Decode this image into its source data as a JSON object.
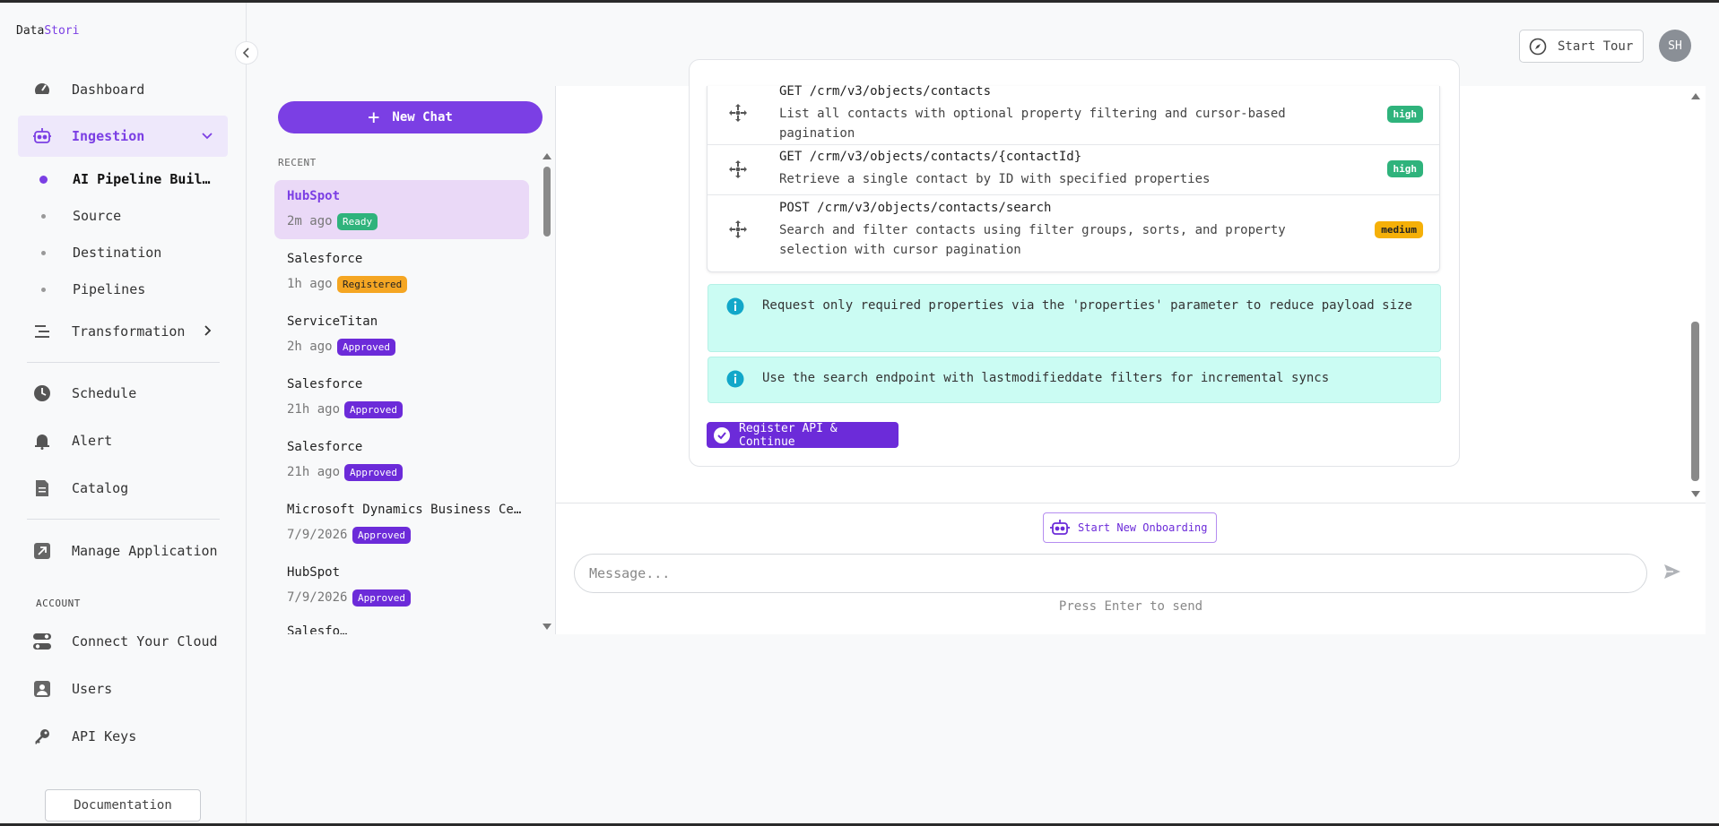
{
  "brand": {
    "part1": "Data",
    "part2": "Stori"
  },
  "sidebar": {
    "items": [
      {
        "label": "Dashboard",
        "icon": "gauge-icon"
      },
      {
        "label": "Ingestion",
        "icon": "robot-icon"
      },
      {
        "label": "Transformation",
        "icon": "transform-icon"
      },
      {
        "label": "Schedule",
        "icon": "clock-icon"
      },
      {
        "label": "Alert",
        "icon": "bell-icon"
      },
      {
        "label": "Catalog",
        "icon": "document-icon"
      },
      {
        "label": "Manage Application",
        "icon": "external-link-icon"
      },
      {
        "label": "Connect Your Cloud",
        "icon": "toggle-icon"
      },
      {
        "label": "Users",
        "icon": "user-icon"
      },
      {
        "label": "API Keys",
        "icon": "key-icon"
      }
    ],
    "sub_items": [
      "AI Pipeline Buil…",
      "Source",
      "Destination",
      "Pipelines"
    ],
    "account_label": "ACCOUNT",
    "documentation": "Documentation"
  },
  "header": {
    "tour": "Start Tour",
    "avatar": "SH"
  },
  "chats": {
    "new_chat": "New Chat",
    "recent_label": "RECENT",
    "items": [
      {
        "name": "HubSpot",
        "time": "2m ago",
        "status": "Ready"
      },
      {
        "name": "Salesforce",
        "time": "1h ago",
        "status": "Registered"
      },
      {
        "name": "ServiceTitan",
        "time": "2h ago",
        "status": "Approved"
      },
      {
        "name": "Salesforce",
        "time": "21h ago",
        "status": "Approved"
      },
      {
        "name": "Salesforce",
        "time": "21h ago",
        "status": "Approved"
      },
      {
        "name": "Microsoft Dynamics Business Cen…",
        "time": "7/9/2026",
        "status": "Approved"
      },
      {
        "name": "HubSpot",
        "time": "7/9/2026",
        "status": "Approved"
      },
      {
        "name": "Salesfo…",
        "time": "",
        "status": ""
      }
    ]
  },
  "endpoints": [
    {
      "method": "GET /crm/v3/objects/contacts",
      "desc": "List all contacts with optional property filtering and cursor-based pagination",
      "priority": "high"
    },
    {
      "method": "GET /crm/v3/objects/contacts/{contactId}",
      "desc": "Retrieve a single contact by ID with specified properties",
      "priority": "high"
    },
    {
      "method": "POST /crm/v3/objects/contacts/search",
      "desc": "Search and filter contacts using filter groups, sorts, and property selection with cursor pagination",
      "priority": "medium"
    }
  ],
  "tips": [
    "Request only required properties via the 'properties' parameter to reduce payload size",
    "Use the search endpoint with lastmodifieddate filters for incremental syncs"
  ],
  "register_button": "Register API & Continue",
  "onboarding_button": "Start New Onboarding",
  "composer": {
    "placeholder": "Message...",
    "hint": "Press Enter to send"
  },
  "colors": {
    "accent": "#7b3fe4",
    "ready": "#2fb37c",
    "registered": "#f5a623",
    "approved": "#6c2bd9",
    "tip_bg": "#cbfcf3"
  }
}
